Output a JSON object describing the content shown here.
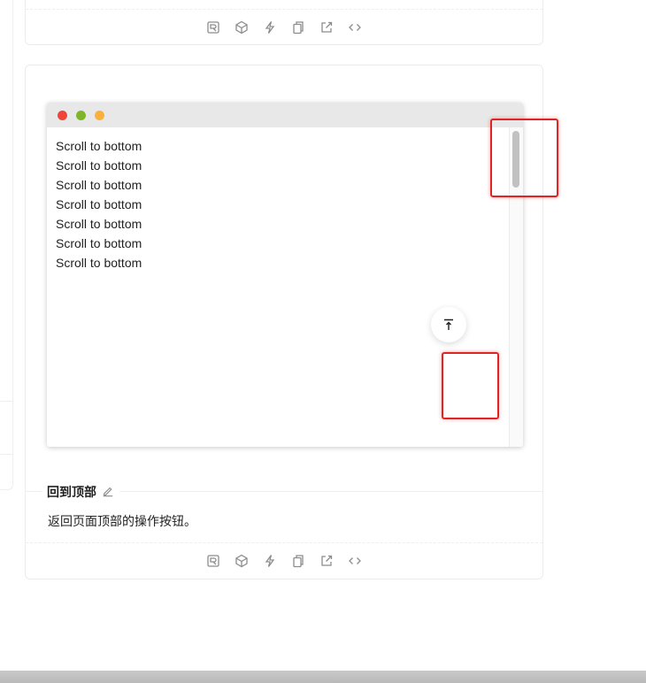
{
  "demo": {
    "window_dots": [
      {
        "name": "close",
        "color": "#f0443b"
      },
      {
        "name": "zoom",
        "color": "#7fb52a"
      },
      {
        "name": "minimize",
        "color": "#fbb03b"
      }
    ],
    "lines": [
      "Scroll to bottom",
      "Scroll to bottom",
      "Scroll to bottom",
      "Scroll to bottom",
      "Scroll to bottom",
      "Scroll to bottom",
      "Scroll to bottom"
    ],
    "back_top_icon": "vertical-align-top-icon"
  },
  "meta": {
    "title": "回到顶部",
    "edit_icon": "edit-icon",
    "description": "返回页面顶部的操作按钮。"
  },
  "actions": [
    {
      "name": "codesandbox-icon"
    },
    {
      "name": "codepen-box-icon"
    },
    {
      "name": "stackblitz-icon"
    },
    {
      "name": "copy-icon"
    },
    {
      "name": "external-link-icon"
    },
    {
      "name": "code-icon"
    }
  ],
  "highlight_color": "#e02424"
}
